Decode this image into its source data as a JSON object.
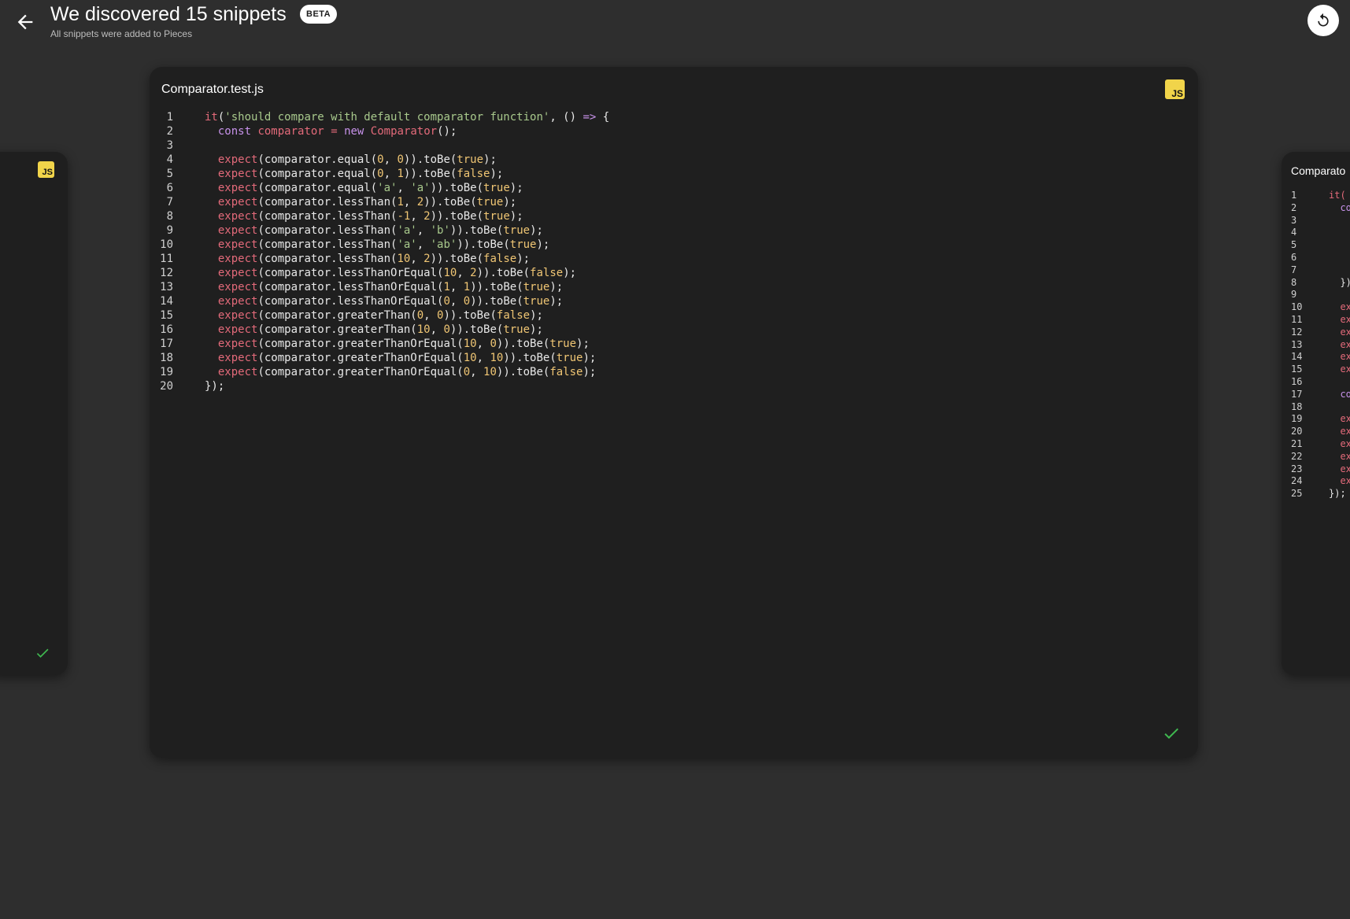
{
  "header": {
    "title": "We discovered 15 snippets",
    "badge": "BETA",
    "subtitle": "All snippets were added to Pieces"
  },
  "icons": {
    "back": "arrow-left-icon",
    "refresh": "refresh-icon",
    "language": "javascript-icon",
    "saved": "checkmark-icon"
  },
  "colors": {
    "background": "#2e2e2e",
    "card": "#1f1f1f",
    "js_badge": "#f1d44a",
    "check": "#3fb950",
    "keyword": "#e36a7a",
    "string": "#a8c98c",
    "number": "#f0c674",
    "purple": "#c792ea"
  },
  "main_snippet": {
    "filename": "Comparator.test.js",
    "language_badge": "JS",
    "line_numbers": [
      "1",
      "2",
      "3",
      "4",
      "5",
      "6",
      "7",
      "8",
      "9",
      "10",
      "11",
      "12",
      "13",
      "14",
      "15",
      "16",
      "17",
      "18",
      "19",
      "20"
    ],
    "lines": [
      [
        [
          "kw",
          "it"
        ],
        [
          "default",
          "("
        ],
        [
          "str",
          "'should compare with default comparator function'"
        ],
        [
          "default",
          ", () "
        ],
        [
          "purple",
          "=>"
        ],
        [
          "default",
          " {"
        ]
      ],
      [
        [
          "default",
          "  "
        ],
        [
          "purple",
          "const"
        ],
        [
          "default",
          " "
        ],
        [
          "kw",
          "comparator"
        ],
        [
          "default",
          " "
        ],
        [
          "kw",
          "="
        ],
        [
          "default",
          " "
        ],
        [
          "purple",
          "new"
        ],
        [
          "default",
          " "
        ],
        [
          "kw",
          "Comparator"
        ],
        [
          "default",
          "();"
        ]
      ],
      [],
      [
        [
          "default",
          "  "
        ],
        [
          "kw",
          "expect"
        ],
        [
          "default",
          "(comparator.equal("
        ],
        [
          "num",
          "0"
        ],
        [
          "default",
          ", "
        ],
        [
          "num",
          "0"
        ],
        [
          "default",
          ")).toBe("
        ],
        [
          "bool",
          "true"
        ],
        [
          "default",
          ");"
        ]
      ],
      [
        [
          "default",
          "  "
        ],
        [
          "kw",
          "expect"
        ],
        [
          "default",
          "(comparator.equal("
        ],
        [
          "num",
          "0"
        ],
        [
          "default",
          ", "
        ],
        [
          "num",
          "1"
        ],
        [
          "default",
          ")).toBe("
        ],
        [
          "bool",
          "false"
        ],
        [
          "default",
          ");"
        ]
      ],
      [
        [
          "default",
          "  "
        ],
        [
          "kw",
          "expect"
        ],
        [
          "default",
          "(comparator.equal("
        ],
        [
          "str",
          "'a'"
        ],
        [
          "default",
          ", "
        ],
        [
          "str",
          "'a'"
        ],
        [
          "default",
          ")).toBe("
        ],
        [
          "bool",
          "true"
        ],
        [
          "default",
          ");"
        ]
      ],
      [
        [
          "default",
          "  "
        ],
        [
          "kw",
          "expect"
        ],
        [
          "default",
          "(comparator.lessThan("
        ],
        [
          "num",
          "1"
        ],
        [
          "default",
          ", "
        ],
        [
          "num",
          "2"
        ],
        [
          "default",
          ")).toBe("
        ],
        [
          "bool",
          "true"
        ],
        [
          "default",
          ");"
        ]
      ],
      [
        [
          "default",
          "  "
        ],
        [
          "kw",
          "expect"
        ],
        [
          "default",
          "(comparator.lessThan("
        ],
        [
          "num",
          "-1"
        ],
        [
          "default",
          ", "
        ],
        [
          "num",
          "2"
        ],
        [
          "default",
          ")).toBe("
        ],
        [
          "bool",
          "true"
        ],
        [
          "default",
          ");"
        ]
      ],
      [
        [
          "default",
          "  "
        ],
        [
          "kw",
          "expect"
        ],
        [
          "default",
          "(comparator.lessThan("
        ],
        [
          "str",
          "'a'"
        ],
        [
          "default",
          ", "
        ],
        [
          "str",
          "'b'"
        ],
        [
          "default",
          ")).toBe("
        ],
        [
          "bool",
          "true"
        ],
        [
          "default",
          ");"
        ]
      ],
      [
        [
          "default",
          "  "
        ],
        [
          "kw",
          "expect"
        ],
        [
          "default",
          "(comparator.lessThan("
        ],
        [
          "str",
          "'a'"
        ],
        [
          "default",
          ", "
        ],
        [
          "str",
          "'ab'"
        ],
        [
          "default",
          ")).toBe("
        ],
        [
          "bool",
          "true"
        ],
        [
          "default",
          ");"
        ]
      ],
      [
        [
          "default",
          "  "
        ],
        [
          "kw",
          "expect"
        ],
        [
          "default",
          "(comparator.lessThan("
        ],
        [
          "num",
          "10"
        ],
        [
          "default",
          ", "
        ],
        [
          "num",
          "2"
        ],
        [
          "default",
          ")).toBe("
        ],
        [
          "bool",
          "false"
        ],
        [
          "default",
          ");"
        ]
      ],
      [
        [
          "default",
          "  "
        ],
        [
          "kw",
          "expect"
        ],
        [
          "default",
          "(comparator.lessThanOrEqual("
        ],
        [
          "num",
          "10"
        ],
        [
          "default",
          ", "
        ],
        [
          "num",
          "2"
        ],
        [
          "default",
          ")).toBe("
        ],
        [
          "bool",
          "false"
        ],
        [
          "default",
          ");"
        ]
      ],
      [
        [
          "default",
          "  "
        ],
        [
          "kw",
          "expect"
        ],
        [
          "default",
          "(comparator.lessThanOrEqual("
        ],
        [
          "num",
          "1"
        ],
        [
          "default",
          ", "
        ],
        [
          "num",
          "1"
        ],
        [
          "default",
          ")).toBe("
        ],
        [
          "bool",
          "true"
        ],
        [
          "default",
          ");"
        ]
      ],
      [
        [
          "default",
          "  "
        ],
        [
          "kw",
          "expect"
        ],
        [
          "default",
          "(comparator.lessThanOrEqual("
        ],
        [
          "num",
          "0"
        ],
        [
          "default",
          ", "
        ],
        [
          "num",
          "0"
        ],
        [
          "default",
          ")).toBe("
        ],
        [
          "bool",
          "true"
        ],
        [
          "default",
          ");"
        ]
      ],
      [
        [
          "default",
          "  "
        ],
        [
          "kw",
          "expect"
        ],
        [
          "default",
          "(comparator.greaterThan("
        ],
        [
          "num",
          "0"
        ],
        [
          "default",
          ", "
        ],
        [
          "num",
          "0"
        ],
        [
          "default",
          ")).toBe("
        ],
        [
          "bool",
          "false"
        ],
        [
          "default",
          ");"
        ]
      ],
      [
        [
          "default",
          "  "
        ],
        [
          "kw",
          "expect"
        ],
        [
          "default",
          "(comparator.greaterThan("
        ],
        [
          "num",
          "10"
        ],
        [
          "default",
          ", "
        ],
        [
          "num",
          "0"
        ],
        [
          "default",
          ")).toBe("
        ],
        [
          "bool",
          "true"
        ],
        [
          "default",
          ");"
        ]
      ],
      [
        [
          "default",
          "  "
        ],
        [
          "kw",
          "expect"
        ],
        [
          "default",
          "(comparator.greaterThanOrEqual("
        ],
        [
          "num",
          "10"
        ],
        [
          "default",
          ", "
        ],
        [
          "num",
          "0"
        ],
        [
          "default",
          ")).toBe("
        ],
        [
          "bool",
          "true"
        ],
        [
          "default",
          ");"
        ]
      ],
      [
        [
          "default",
          "  "
        ],
        [
          "kw",
          "expect"
        ],
        [
          "default",
          "(comparator.greaterThanOrEqual("
        ],
        [
          "num",
          "10"
        ],
        [
          "default",
          ", "
        ],
        [
          "num",
          "10"
        ],
        [
          "default",
          ")).toBe("
        ],
        [
          "bool",
          "true"
        ],
        [
          "default",
          ");"
        ]
      ],
      [
        [
          "default",
          "  "
        ],
        [
          "kw",
          "expect"
        ],
        [
          "default",
          "(comparator.greaterThanOrEqual("
        ],
        [
          "num",
          "0"
        ],
        [
          "default",
          ", "
        ],
        [
          "num",
          "10"
        ],
        [
          "default",
          ")).toBe("
        ],
        [
          "bool",
          "false"
        ],
        [
          "default",
          ");"
        ]
      ],
      [
        [
          "default",
          "});"
        ]
      ]
    ]
  },
  "left_snippet": {
    "language_badge": "JS"
  },
  "right_snippet": {
    "filename": "Comparato",
    "line_numbers": [
      "1",
      "2",
      "3",
      "4",
      "5",
      "6",
      "7",
      "8",
      "9",
      "10",
      "11",
      "12",
      "13",
      "14",
      "15",
      "16",
      "17",
      "18",
      "19",
      "20",
      "21",
      "22",
      "23",
      "24",
      "25"
    ],
    "lines": [
      [
        [
          "kw",
          "it("
        ]
      ],
      [
        [
          "default",
          "  "
        ],
        [
          "purple",
          "co"
        ]
      ],
      [],
      [],
      [],
      [],
      [],
      [
        [
          "default",
          "  })"
        ]
      ],
      [],
      [
        [
          "default",
          "  "
        ],
        [
          "kw",
          "ex"
        ]
      ],
      [
        [
          "default",
          "  "
        ],
        [
          "kw",
          "ex"
        ]
      ],
      [
        [
          "default",
          "  "
        ],
        [
          "kw",
          "ex"
        ]
      ],
      [
        [
          "default",
          "  "
        ],
        [
          "kw",
          "ex"
        ]
      ],
      [
        [
          "default",
          "  "
        ],
        [
          "kw",
          "ex"
        ]
      ],
      [
        [
          "default",
          "  "
        ],
        [
          "kw",
          "ex"
        ]
      ],
      [],
      [
        [
          "default",
          "  "
        ],
        [
          "purple",
          "co"
        ]
      ],
      [],
      [
        [
          "default",
          "  "
        ],
        [
          "kw",
          "ex"
        ]
      ],
      [
        [
          "default",
          "  "
        ],
        [
          "kw",
          "ex"
        ]
      ],
      [
        [
          "default",
          "  "
        ],
        [
          "kw",
          "ex"
        ]
      ],
      [
        [
          "default",
          "  "
        ],
        [
          "kw",
          "ex"
        ]
      ],
      [
        [
          "default",
          "  "
        ],
        [
          "kw",
          "ex"
        ]
      ],
      [
        [
          "default",
          "  "
        ],
        [
          "kw",
          "ex"
        ]
      ],
      [
        [
          "default",
          "});"
        ]
      ]
    ]
  }
}
